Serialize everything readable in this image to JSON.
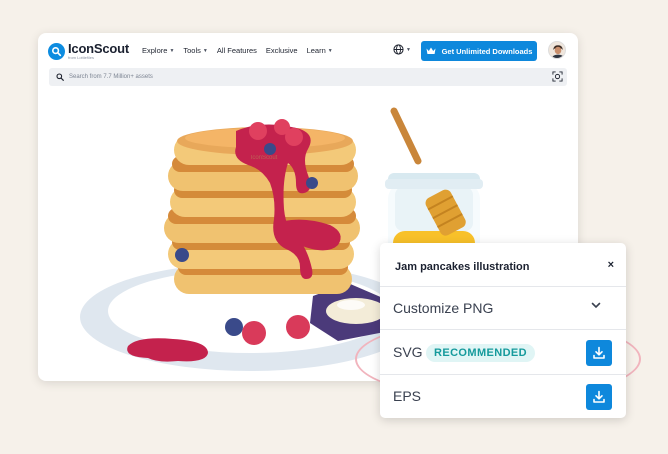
{
  "brand": {
    "name": "IconScout",
    "tagline": "from Lottiefiles"
  },
  "nav": [
    {
      "label": "Explore",
      "has_caret": true
    },
    {
      "label": "Tools",
      "has_caret": true
    },
    {
      "label": "All Features",
      "has_caret": false
    },
    {
      "label": "Exclusive",
      "has_caret": false
    },
    {
      "label": "Learn",
      "has_caret": true
    }
  ],
  "header": {
    "cta_label": "Get Unlimited Downloads"
  },
  "search": {
    "placeholder": "Search from 7.7 Million+ assets"
  },
  "illustration": {
    "watermark": "IconScout"
  },
  "download_panel": {
    "title": "Jam pancakes illustration",
    "close_symbol": "×",
    "options": [
      {
        "label": "Customize PNG",
        "action": "expand"
      },
      {
        "label": "SVG",
        "badge": "RECOMMENDED",
        "action": "download"
      },
      {
        "label": "EPS",
        "action": "download"
      }
    ]
  },
  "colors": {
    "accent": "#0e88dc",
    "badge_text": "#159a9c",
    "badge_bg": "#e0f5f5",
    "highlight_ring": "#f1b4bd",
    "background": "#f6f1ea"
  },
  "icons": [
    "search-icon",
    "globe-icon",
    "crown-icon",
    "avatar",
    "visual-search-icon",
    "chevron-down-icon",
    "download-icon",
    "close-icon"
  ]
}
